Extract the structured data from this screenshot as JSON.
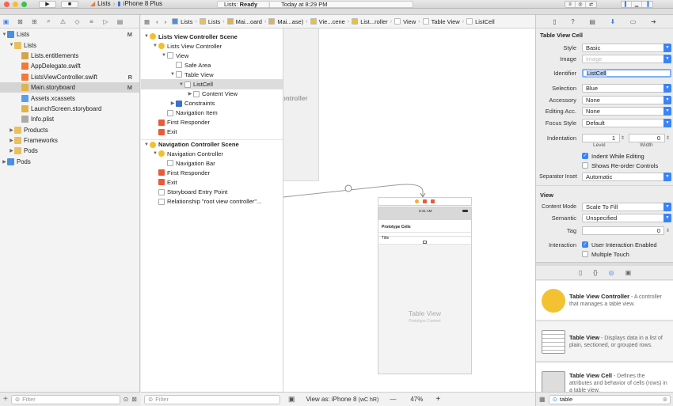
{
  "toolbar": {
    "scheme_app": "Lists",
    "scheme_device": "iPhone 8 Plus",
    "status_project": "Lists:",
    "status_state": "Ready",
    "status_time": "Today at 8:29 PM"
  },
  "navigator": {
    "items": [
      {
        "label": "Lists",
        "indent": 0,
        "tri": "▼",
        "color": "#4a90e2",
        "flag": "M"
      },
      {
        "label": "Lists",
        "indent": 1,
        "tri": "▼",
        "color": "#e8c060",
        "flag": ""
      },
      {
        "label": "Lists.entitlements",
        "indent": 2,
        "tri": "",
        "color": "#d4a44a",
        "flag": ""
      },
      {
        "label": "AppDelegate.swift",
        "indent": 2,
        "tri": "",
        "color": "#f07a3a",
        "flag": ""
      },
      {
        "label": "ListsViewController.swift",
        "indent": 2,
        "tri": "",
        "color": "#f07a3a",
        "flag": "R"
      },
      {
        "label": "Main.storyboard",
        "indent": 2,
        "tri": "",
        "color": "#e2b34a",
        "flag": "M",
        "selected": true
      },
      {
        "label": "Assets.xcassets",
        "indent": 2,
        "tri": "",
        "color": "#5aa0e8",
        "flag": ""
      },
      {
        "label": "LaunchScreen.storyboard",
        "indent": 2,
        "tri": "",
        "color": "#e2b34a",
        "flag": ""
      },
      {
        "label": "Info.plist",
        "indent": 2,
        "tri": "",
        "color": "#aaaaaa",
        "flag": ""
      },
      {
        "label": "Products",
        "indent": 1,
        "tri": "▶",
        "color": "#e8c060",
        "flag": ""
      },
      {
        "label": "Frameworks",
        "indent": 1,
        "tri": "▶",
        "color": "#e8c060",
        "flag": ""
      },
      {
        "label": "Pods",
        "indent": 1,
        "tri": "▶",
        "color": "#e8c060",
        "flag": ""
      },
      {
        "label": "Pods",
        "indent": 0,
        "tri": "▶",
        "color": "#4a90e2",
        "flag": ""
      }
    ],
    "filter_placeholder": "Filter"
  },
  "jumpbar": {
    "crumbs": [
      "Lists",
      "Lists",
      "Mai...oard",
      "Mai...ase)",
      "Vie...cene",
      "List...roller",
      "View",
      "Table View",
      "ListCell"
    ]
  },
  "outline": {
    "items": [
      {
        "label": "Lists View Controller Scene",
        "indent": 0,
        "tri": "▼",
        "color": "#f0c030",
        "scene": true
      },
      {
        "label": "Lists View Controller",
        "indent": 1,
        "tri": "▼",
        "color": "#f0c030"
      },
      {
        "label": "View",
        "indent": 2,
        "tri": "▼",
        "color": "#ffffff"
      },
      {
        "label": "Safe Area",
        "indent": 3,
        "tri": "",
        "color": "#ffffff"
      },
      {
        "label": "Table View",
        "indent": 3,
        "tri": "▼",
        "color": "#ffffff"
      },
      {
        "label": "ListCell",
        "indent": 4,
        "tri": "▼",
        "color": "#ffffff",
        "selected": true
      },
      {
        "label": "Content View",
        "indent": 5,
        "tri": "▶",
        "color": "#ffffff"
      },
      {
        "label": "Constraints",
        "indent": 3,
        "tri": "▶",
        "color": "#3b6fd0"
      },
      {
        "label": "Navigation Item",
        "indent": 2,
        "tri": "",
        "color": "#ffffff"
      },
      {
        "label": "First Responder",
        "indent": 1,
        "tri": "",
        "color": "#e85a3a"
      },
      {
        "label": "Exit",
        "indent": 1,
        "tri": "",
        "color": "#e85a3a"
      },
      {
        "label": "Navigation Controller Scene",
        "indent": 0,
        "tri": "▼",
        "color": "#f0c030",
        "scene": true
      },
      {
        "label": "Navigation Controller",
        "indent": 1,
        "tri": "▼",
        "color": "#f0c030"
      },
      {
        "label": "Navigation Bar",
        "indent": 2,
        "tri": "",
        "color": "#ffffff"
      },
      {
        "label": "First Responder",
        "indent": 1,
        "tri": "",
        "color": "#e85a3a"
      },
      {
        "label": "Exit",
        "indent": 1,
        "tri": "",
        "color": "#e85a3a"
      },
      {
        "label": "Storyboard Entry Point",
        "indent": 1,
        "tri": "",
        "color": "#ffffff"
      },
      {
        "label": "Relationship \"root view controller\"...",
        "indent": 1,
        "tri": "",
        "color": "#ffffff"
      }
    ],
    "filter_placeholder": "Filter"
  },
  "canvas": {
    "ghost_label": "ontroller",
    "scene_status_time": "9:41 AM",
    "prototype_cells": "Prototype Cells",
    "cell_title": "Title",
    "table_view_title": "Table View",
    "table_view_subtitle": "Prototype Content",
    "view_as": "View as: iPhone 8",
    "size_class": "(wC hR)",
    "zoom_minus": "—",
    "zoom": "47%",
    "zoom_plus": "+"
  },
  "inspector": {
    "section_cell": "Table View Cell",
    "style_label": "Style",
    "style_value": "Basic",
    "image_label": "Image",
    "image_placeholder": "image",
    "identifier_label": "Identifier",
    "identifier_value": "ListCell",
    "selection_label": "Selection",
    "selection_value": "Blue",
    "accessory_label": "Accessory",
    "accessory_value": "None",
    "editing_label": "Editing Acc.",
    "editing_value": "None",
    "focus_label": "Focus Style",
    "focus_value": "Default",
    "indentation_label": "Indentation",
    "indent_level": "1",
    "indent_width": "0",
    "level_label": "Level",
    "width_label": "Width",
    "indent_while_editing": "Indent While Editing",
    "shows_reorder": "Shows Re-order Controls",
    "separator_label": "Separator Inset",
    "separator_value": "Automatic",
    "section_view": "View",
    "content_mode_label": "Content Mode",
    "content_mode_value": "Scale To Fill",
    "semantic_label": "Semantic",
    "semantic_value": "Unspecified",
    "tag_label": "Tag",
    "tag_value": "0",
    "interaction_label": "Interaction",
    "user_interaction": "User Interaction Enabled",
    "multiple_touch": "Multiple Touch",
    "library": [
      {
        "title": "Table View Controller",
        "desc": " - A controller that manages a table view.",
        "icon": "table-view-controller-icon"
      },
      {
        "title": "Table View",
        "desc": " - Displays data in a list of plain, sectioned, or grouped rows.",
        "icon": "table-view-icon"
      },
      {
        "title": "Table View Cell",
        "desc": " - Defines the attributes and behavior of cells (rows) in a table view.",
        "icon": "table-view-cell-icon"
      }
    ],
    "library_search": "table"
  },
  "colors": {
    "accent": "#3b84f5",
    "close": "#fc5f57",
    "minimize": "#fdbc2e",
    "zoom": "#33c748"
  }
}
